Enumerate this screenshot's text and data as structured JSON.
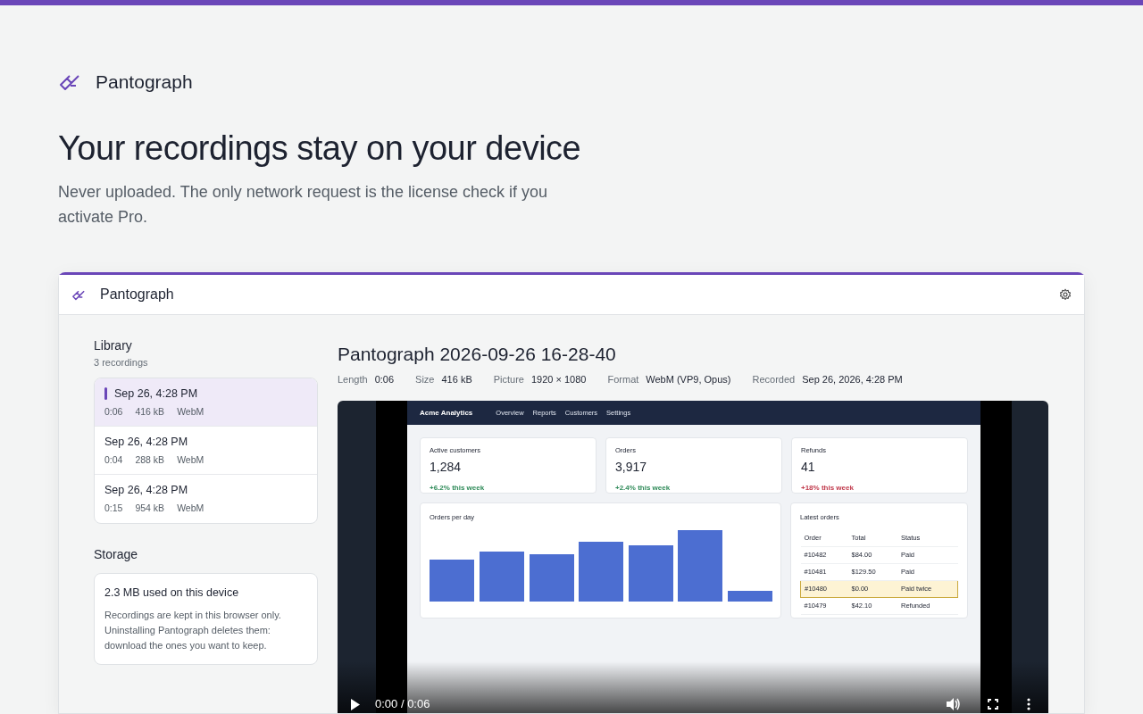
{
  "brand": {
    "name": "Pantograph"
  },
  "hero": {
    "title": "Your recordings stay on your device",
    "subtitle": "Never uploaded. The only network request is the license check if you activate Pro."
  },
  "app": {
    "title": "Pantograph",
    "library": {
      "heading": "Library",
      "count": "3 recordings",
      "items": [
        {
          "date": "Sep 26, 4:28 PM",
          "duration": "0:06",
          "size": "416 kB",
          "format": "WebM",
          "selected": true
        },
        {
          "date": "Sep 26, 4:28 PM",
          "duration": "0:04",
          "size": "288 kB",
          "format": "WebM",
          "selected": false
        },
        {
          "date": "Sep 26, 4:28 PM",
          "duration": "0:15",
          "size": "954 kB",
          "format": "WebM",
          "selected": false
        }
      ]
    },
    "storage": {
      "heading": "Storage",
      "usage": "2.3 MB used on this device",
      "note": "Recordings are kept in this browser only. Uninstalling Pantograph deletes them: download the ones you want to keep."
    },
    "recording": {
      "title": "Pantograph 2026-09-26 16-28-40",
      "meta": [
        {
          "label": "Length",
          "value": "0:06"
        },
        {
          "label": "Size",
          "value": "416 kB"
        },
        {
          "label": "Picture",
          "value": "1920 × 1080"
        },
        {
          "label": "Format",
          "value": "WebM (VP9, Opus)"
        },
        {
          "label": "Recorded",
          "value": "Sep 26, 2026, 4:28 PM"
        }
      ]
    },
    "video": {
      "time": "0:00 / 0:06",
      "frame": {
        "brand": "Acme Analytics",
        "nav": [
          "Overview",
          "Reports",
          "Customers",
          "Settings"
        ],
        "stats": [
          {
            "label": "Active customers",
            "value": "1,284",
            "delta": "+6.2% this week",
            "color": "#2e8a58"
          },
          {
            "label": "Orders",
            "value": "3,917",
            "delta": "+2.4% this week",
            "color": "#2e8a58"
          },
          {
            "label": "Refunds",
            "value": "41",
            "delta": "+18% this week",
            "color": "#c0394b"
          }
        ],
        "chart_title": "Orders per day",
        "orders": {
          "title": "Latest orders",
          "columns": [
            "Order",
            "Total",
            "Status"
          ],
          "rows": [
            {
              "cells": [
                "#10482",
                "$84.00",
                "Paid"
              ],
              "highlighted": false
            },
            {
              "cells": [
                "#10481",
                "$129.50",
                "Paid"
              ],
              "highlighted": false
            },
            {
              "cells": [
                "#10480",
                "$0.00",
                "Paid twice"
              ],
              "highlighted": true
            },
            {
              "cells": [
                "#10479",
                "$42.10",
                "Refunded"
              ],
              "highlighted": false
            }
          ]
        }
      }
    }
  }
}
